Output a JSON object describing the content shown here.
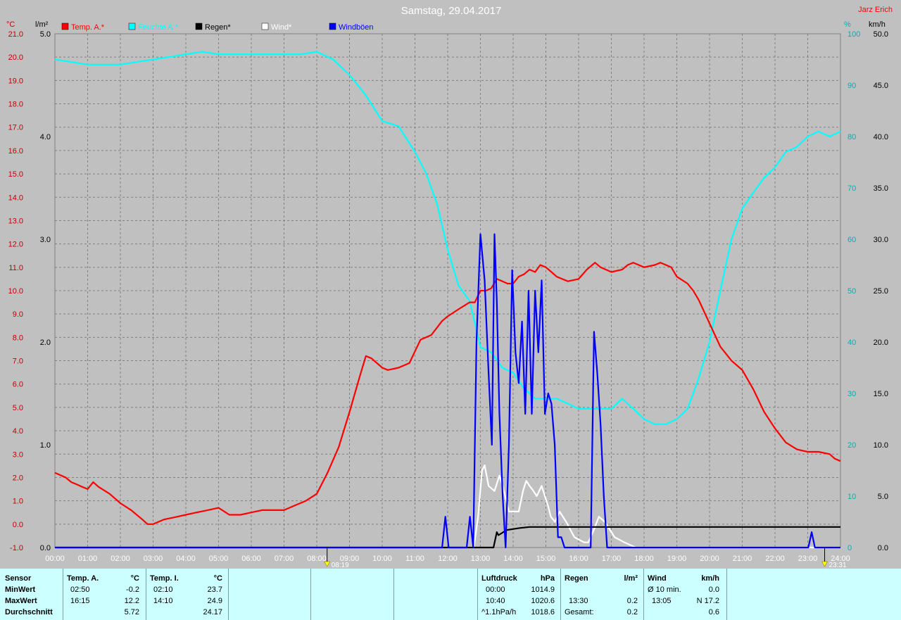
{
  "title": "Samstag, 29.04.2017",
  "author": "Jarz Erich",
  "legend": [
    {
      "label": "Temp. A.*",
      "color": "#ff0000"
    },
    {
      "label": "Feuchte A.*",
      "color": "#00ffff"
    },
    {
      "label": "Regen*",
      "color": "#000000"
    },
    {
      "label": "Wind*",
      "color": "#ffffff"
    },
    {
      "label": "Windböen",
      "color": "#0000ff"
    }
  ],
  "axes": {
    "temp_unit": "°C",
    "rain_unit": "l/m²",
    "humidity_unit": "%",
    "wind_unit": "km/h",
    "temp_ticks": [
      "21.0",
      "20.0",
      "19.0",
      "18.0",
      "17.0",
      "16.0",
      "15.0",
      "14.0",
      "13.0",
      "12.0",
      "11.0",
      "10.0",
      "9.0",
      "8.0",
      "7.0",
      "6.0",
      "5.0",
      "4.0",
      "3.0",
      "2.0",
      "1.0",
      "0.0",
      "-1.0"
    ],
    "rain_ticks": [
      "5.0",
      "4.0",
      "3.0",
      "2.0",
      "1.0",
      "0.0"
    ],
    "humidity_ticks": [
      "100",
      "90",
      "80",
      "70",
      "60",
      "50",
      "40",
      "30",
      "20",
      "10",
      "0"
    ],
    "wind_ticks": [
      "50.0",
      "45.0",
      "40.0",
      "35.0",
      "30.0",
      "25.0",
      "20.0",
      "15.0",
      "10.0",
      "5.0",
      "0.0"
    ],
    "time_ticks": [
      "00:00",
      "01:00",
      "02:00",
      "03:00",
      "04:00",
      "05:00",
      "06:00",
      "07:00",
      "08:00",
      "09:00",
      "10:00",
      "11:00",
      "12:00",
      "13:00",
      "14:00",
      "15:00",
      "16:00",
      "17:00",
      "18:00",
      "19:00",
      "20:00",
      "21:00",
      "22:00",
      "23:00",
      "24:00"
    ]
  },
  "markers": {
    "sunrise": "08:19",
    "sunset": "23:31"
  },
  "colors": {
    "background": "#c0c0c0",
    "grid": "#808080",
    "stats_bg": "#ccffff",
    "temp_axis": "#c00000",
    "humidity_axis": "#00b0b0",
    "wind_axis": "#000000"
  },
  "chart_data": {
    "type": "line",
    "title": "Samstag, 29.04.2017",
    "x_unit": "hours",
    "xlim": [
      0,
      24
    ],
    "axis_ranges": {
      "temperature": [
        -1,
        21
      ],
      "rain": [
        0,
        5
      ],
      "humidity": [
        0,
        100
      ],
      "wind": [
        0,
        50
      ]
    },
    "grid": true,
    "legend_placement": "top-left",
    "series": [
      {
        "name": "Temp. A.*",
        "axis": "temperature",
        "color": "#ff0000",
        "x": [
          0,
          0.33,
          0.5,
          0.67,
          0.83,
          1,
          1.17,
          1.33,
          1.67,
          2,
          2.33,
          2.67,
          2.83,
          3,
          3.33,
          3.67,
          4,
          4.33,
          4.67,
          5,
          5.33,
          5.67,
          6,
          6.33,
          6.67,
          7,
          7.33,
          7.67,
          8,
          8.33,
          8.67,
          9,
          9.33,
          9.5,
          9.67,
          10,
          10.17,
          10.5,
          10.83,
          11,
          11.17,
          11.5,
          11.83,
          12,
          12.33,
          12.67,
          12.83,
          13,
          13.17,
          13.33,
          13.5,
          13.67,
          13.83,
          14,
          14.17,
          14.33,
          14.5,
          14.67,
          14.83,
          15,
          15.17,
          15.33,
          15.67,
          16,
          16.25,
          16.5,
          16.67,
          17,
          17.33,
          17.5,
          17.67,
          18,
          18.33,
          18.5,
          18.83,
          19,
          19.33,
          19.5,
          19.67,
          20,
          20.33,
          20.67,
          21,
          21.33,
          21.67,
          22,
          22.33,
          22.67,
          23,
          23.33,
          23.67,
          23.83,
          24
        ],
        "values": [
          2.2,
          2.0,
          1.8,
          1.7,
          1.6,
          1.5,
          1.8,
          1.6,
          1.3,
          0.9,
          0.6,
          0.2,
          0.0,
          -0.0,
          0.2,
          0.3,
          0.4,
          0.5,
          0.6,
          0.7,
          0.4,
          0.4,
          0.5,
          0.6,
          0.6,
          0.6,
          0.8,
          1.0,
          1.3,
          2.2,
          3.3,
          4.8,
          6.4,
          7.2,
          7.1,
          6.7,
          6.6,
          6.7,
          6.9,
          7.4,
          7.9,
          8.1,
          8.7,
          8.9,
          9.2,
          9.5,
          9.5,
          10.0,
          10.0,
          10.1,
          10.5,
          10.4,
          10.3,
          10.3,
          10.6,
          10.7,
          10.9,
          10.8,
          11.1,
          11.0,
          10.8,
          10.6,
          10.4,
          10.5,
          10.9,
          11.2,
          11.0,
          10.8,
          10.9,
          11.1,
          11.2,
          11.0,
          11.1,
          11.2,
          11.0,
          10.6,
          10.3,
          10.0,
          9.6,
          8.6,
          7.6,
          7.0,
          6.6,
          5.8,
          4.8,
          4.1,
          3.5,
          3.2,
          3.1,
          3.1,
          3.0,
          2.8,
          2.7
        ]
      },
      {
        "name": "Feuchte A.*",
        "axis": "humidity",
        "color": "#00ffff",
        "x": [
          0,
          0.5,
          1,
          1.5,
          2,
          2.5,
          3,
          3.5,
          4,
          4.5,
          5,
          5.5,
          6,
          6.5,
          7,
          7.5,
          8,
          8.5,
          9,
          9.5,
          10,
          10.5,
          11,
          11.33,
          11.67,
          12,
          12.33,
          12.67,
          13,
          13.33,
          13.67,
          14,
          14.33,
          14.67,
          15,
          15.33,
          15.67,
          16,
          16.33,
          16.67,
          17,
          17.33,
          17.67,
          18,
          18.33,
          18.67,
          19,
          19.33,
          19.67,
          20,
          20.33,
          20.67,
          21,
          21.33,
          21.67,
          22,
          22.33,
          22.67,
          23,
          23.33,
          23.67,
          24
        ],
        "values": [
          95,
          94.5,
          94,
          94,
          94,
          94.5,
          95,
          95.5,
          96,
          96.5,
          96,
          96,
          96,
          96,
          96,
          96,
          96.5,
          95,
          92,
          88,
          83,
          82,
          77,
          73,
          67,
          58,
          51,
          48,
          39,
          38,
          35,
          34,
          31,
          29,
          29,
          29,
          28,
          27,
          27,
          27,
          27,
          29,
          27,
          25,
          24,
          24,
          25,
          27,
          33,
          40,
          50,
          60,
          66,
          69,
          72,
          74,
          77,
          78,
          80,
          81,
          80,
          81
        ]
      },
      {
        "name": "Regen*",
        "axis": "rain",
        "color": "#000000",
        "x": [
          0,
          13.4,
          13.5,
          13.55,
          13.8,
          14.2,
          14.5,
          24
        ],
        "values": [
          0,
          0,
          0.15,
          0.12,
          0.17,
          0.19,
          0.2,
          0.2
        ]
      },
      {
        "name": "Wind*",
        "axis": "wind",
        "color": "#ffffff",
        "x": [
          0,
          12.8,
          12.93,
          13.05,
          13.13,
          13.25,
          13.43,
          13.58,
          13.68,
          13.87,
          14.05,
          14.17,
          14.3,
          14.4,
          14.5,
          14.62,
          14.72,
          14.87,
          14.97,
          15.07,
          15.15,
          15.28,
          15.42,
          15.62,
          15.87,
          16.17,
          16.3,
          16.5,
          16.62,
          16.8,
          17.1,
          17.4,
          17.75,
          24
        ],
        "values": [
          0,
          0,
          3,
          7.5,
          8,
          6,
          5.5,
          7,
          6,
          3.5,
          3.5,
          3.5,
          5.5,
          6.5,
          6,
          5.5,
          5,
          6,
          5,
          4,
          3,
          2.5,
          3.5,
          2.5,
          1,
          0.5,
          0.5,
          2,
          3,
          2.5,
          1,
          0.5,
          0,
          0
        ]
      },
      {
        "name": "Windböen",
        "axis": "wind",
        "color": "#0000ff",
        "x": [
          0,
          11.83,
          11.93,
          12.03,
          12.58,
          12.68,
          12.78,
          12.88,
          13,
          13.13,
          13.25,
          13.35,
          13.43,
          13.5,
          13.58,
          13.68,
          13.77,
          13.87,
          13.97,
          14.07,
          14.17,
          14.27,
          14.37,
          14.47,
          14.57,
          14.67,
          14.77,
          14.87,
          14.97,
          15.07,
          15.17,
          15.27,
          15.37,
          15.47,
          15.57,
          15.67,
          15.77,
          16.37,
          16.47,
          16.57,
          16.67,
          16.77,
          16.87,
          16.97,
          17.07,
          23.02,
          23.12,
          23.22,
          24
        ],
        "values": [
          0,
          0,
          3,
          0,
          0,
          3,
          0,
          20,
          30.5,
          26,
          17,
          10,
          30.5,
          24,
          13,
          5,
          0,
          10,
          27,
          19,
          16,
          22,
          13,
          25,
          13,
          25,
          19,
          26,
          13,
          15,
          14,
          10,
          1,
          1,
          0,
          0,
          0,
          0,
          21,
          17,
          12,
          5,
          0,
          0,
          0,
          0,
          1.5,
          0,
          0
        ]
      }
    ]
  },
  "stats": {
    "sensor_header": "Sensor",
    "row_labels": [
      "MinWert",
      "MaxWert",
      "Durchschnitt"
    ],
    "temp_a": {
      "label": "Temp. A.",
      "unit": "°C",
      "min_time": "02:50",
      "min_val": "-0.2",
      "max_time": "16:15",
      "max_val": "12.2",
      "avg": "5.72"
    },
    "temp_i": {
      "label": "Temp. I.",
      "unit": "°C",
      "min_time": "02:10",
      "min_val": "23.7",
      "max_time": "14:10",
      "max_val": "24.9",
      "avg": "24.17"
    },
    "pressure": {
      "label": "Luftdruck",
      "unit": "hPa",
      "min_time": "00:00",
      "min_val": "1014.9",
      "max_time": "10:40",
      "max_val": "1020.6",
      "trend": "^1.1hPa/h",
      "avg": "1018.6"
    },
    "rain": {
      "label": "Regen",
      "unit": "l/m²",
      "time": "13:30",
      "val": "0.2",
      "total_label": "Gesamt:",
      "total": "0.2"
    },
    "wind": {
      "label": "Wind",
      "unit": "km/h",
      "avg10_label": "Ø 10 min.",
      "avg10": "0.0",
      "max_time": "13:05",
      "max_val": "N 17.2",
      "avg": "0.6"
    }
  }
}
